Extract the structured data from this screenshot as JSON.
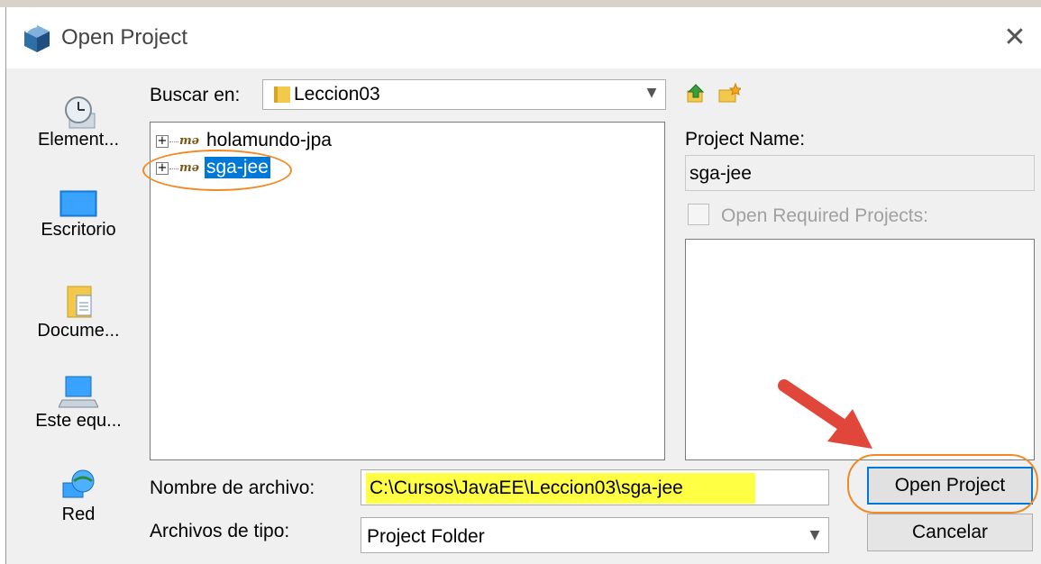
{
  "dialog": {
    "title": "Open Project",
    "close_glyph": "✕"
  },
  "places": [
    {
      "label": "Element...",
      "icon": "recent-items-icon"
    },
    {
      "label": "Escritorio",
      "icon": "desktop-icon"
    },
    {
      "label": "Docume...",
      "icon": "documents-icon"
    },
    {
      "label": "Este equ...",
      "icon": "this-pc-icon"
    },
    {
      "label": "Red",
      "icon": "network-icon"
    }
  ],
  "look_in": {
    "label": "Buscar en:",
    "value": "Leccion03"
  },
  "tree": {
    "items": [
      {
        "label": "holamundo-jpa",
        "selected": false
      },
      {
        "label": "sga-jee",
        "selected": true
      }
    ]
  },
  "project_name": {
    "label": "Project Name:",
    "value": "sga-jee"
  },
  "open_required": {
    "label": "Open Required Projects:",
    "checked": false
  },
  "file_name": {
    "label": "Nombre de archivo:",
    "value": "C:\\Cursos\\JavaEE\\Leccion03\\sga-jee"
  },
  "file_type": {
    "label": "Archivos de tipo:",
    "value": "Project Folder"
  },
  "buttons": {
    "open": "Open Project",
    "cancel": "Cancelar"
  },
  "colors": {
    "selection": "#0078d7",
    "annotation_orange": "#f08a24",
    "annotation_arrow": "#e0473a",
    "highlight_yellow": "#ffff44"
  }
}
